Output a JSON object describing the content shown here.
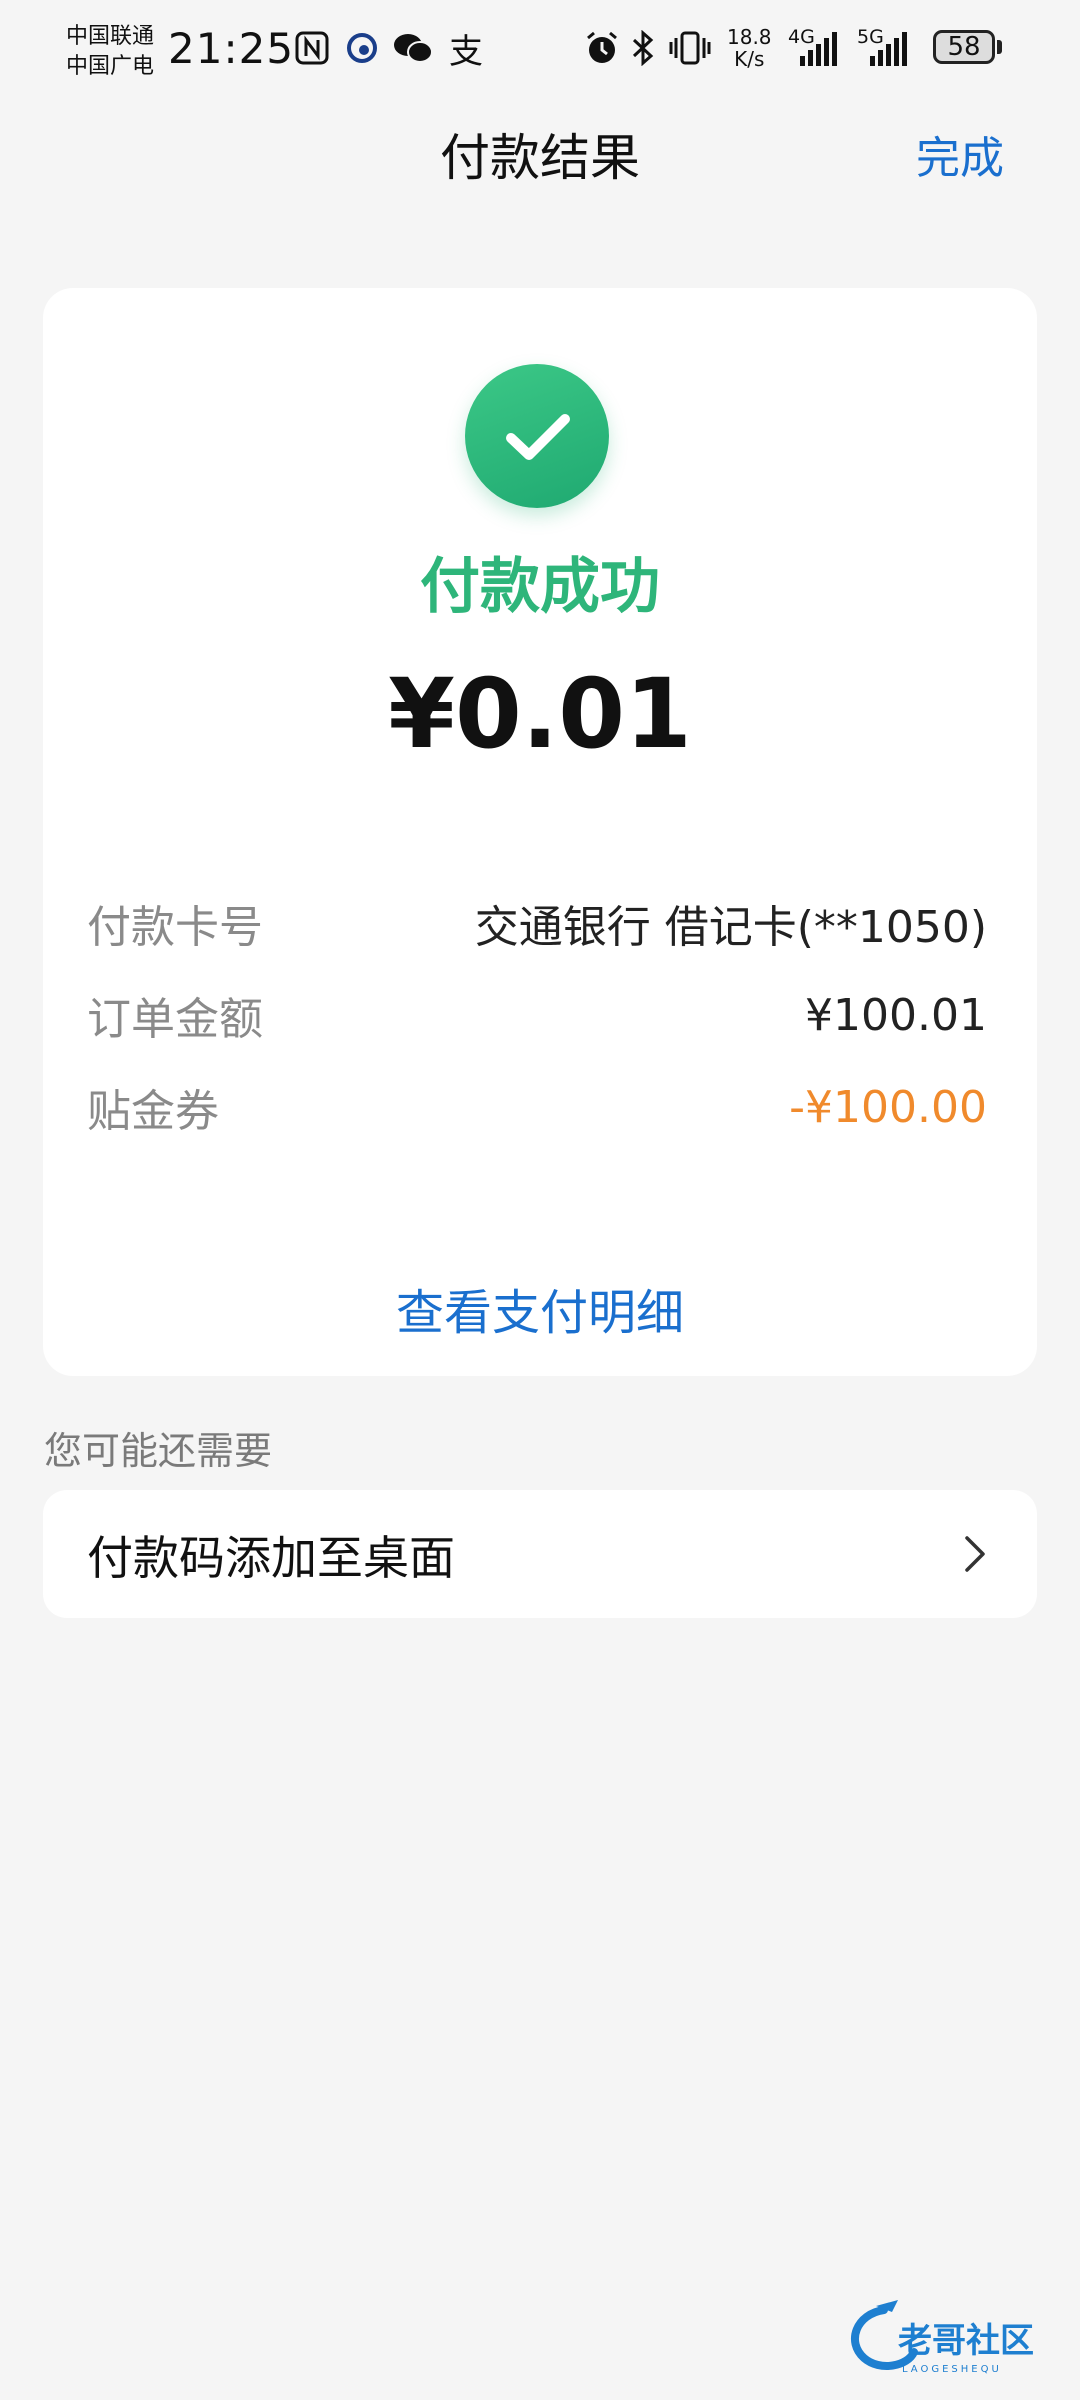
{
  "status_bar": {
    "carrier1": "中国联通",
    "carrier2": "中国广电",
    "time": "21:25",
    "net_speed_value": "18.8",
    "net_speed_unit": "K/s",
    "signal1_label": "4G",
    "signal2_label": "5G",
    "battery": "58",
    "icons": [
      "nfc-icon",
      "app-notification-icon",
      "wechat-icon",
      "alipay-icon",
      "alarm-icon",
      "bluetooth-icon",
      "vibrate-icon"
    ]
  },
  "header": {
    "title": "付款结果",
    "done_label": "完成"
  },
  "result": {
    "status": "付款成功",
    "amount": "¥0.01",
    "rows": [
      {
        "label": "付款卡号",
        "value": "交通银行 借记卡(**1050)"
      },
      {
        "label": "订单金额",
        "value": "¥100.01"
      },
      {
        "label": "贴金券",
        "value": "-¥100.00"
      }
    ],
    "detail_link": "查看支付明细"
  },
  "suggestions": {
    "title": "您可能还需要",
    "items": [
      {
        "label": "付款码添加至桌面"
      }
    ]
  },
  "watermark": {
    "text": "老哥社区",
    "subtext": "LAOGESHEQU"
  },
  "colors": {
    "success_green": "#2eb57a",
    "link_blue": "#1a6fce",
    "discount_orange": "#f08a2c",
    "background": "#f5f5f5"
  }
}
